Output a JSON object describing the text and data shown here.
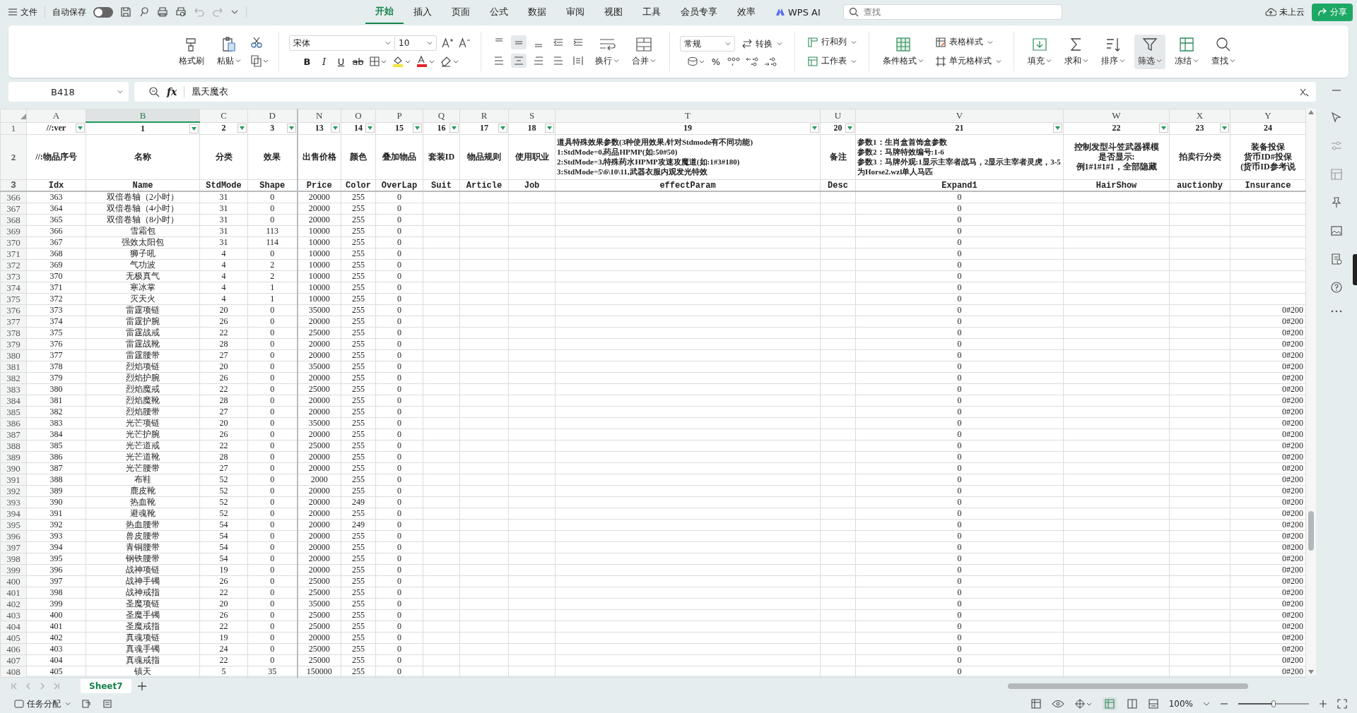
{
  "menu": {
    "file": "文件",
    "autosave": {
      "label": "自动保存",
      "on": false
    },
    "tabs": [
      {
        "label": "开始",
        "selected": true
      },
      {
        "label": "插入",
        "selected": false
      },
      {
        "label": "页面",
        "selected": false
      },
      {
        "label": "公式",
        "selected": false
      },
      {
        "label": "数据",
        "selected": false
      },
      {
        "label": "审阅",
        "selected": false
      },
      {
        "label": "视图",
        "selected": false
      },
      {
        "label": "工具",
        "selected": false
      },
      {
        "label": "会员专享",
        "selected": false
      },
      {
        "label": "效率",
        "selected": false
      },
      {
        "label": "WPS AI",
        "selected": false
      }
    ],
    "search": {
      "placeholder": "查找"
    },
    "cloud": "未上云",
    "share": "分享"
  },
  "ribbon": {
    "format_painter": "格式刷",
    "paste": "粘贴",
    "font": "宋体",
    "font_size": "10",
    "bold": "B",
    "italic": "I",
    "underline": "U",
    "strike": "ab",
    "wrap": "换行",
    "merge": "合并",
    "number_format": "常规",
    "convert": "转换",
    "percent": "%",
    "rows_cols": "行和列",
    "worksheet": "工作表",
    "conditional": "条件格式",
    "table_style": "表格样式",
    "cell_style": "单元格样式",
    "fill": "填充",
    "sum": "求和",
    "sort": "排序",
    "filter": "筛选",
    "freeze": "冻结",
    "find": "查找"
  },
  "formula_bar": {
    "name_box": "B418",
    "function_label": "fx",
    "content": "凰天魔衣"
  },
  "header_rows": [
    "1",
    "2",
    "3"
  ],
  "columns": [
    {
      "letter": "A",
      "selected": false,
      "row1": "//:ver",
      "row2": [
        "//:物品序号"
      ],
      "row3": "Idx"
    },
    {
      "letter": "B",
      "selected": true,
      "row1": "1",
      "row2": [
        "名称"
      ],
      "row3": "Name"
    },
    {
      "letter": "C",
      "selected": false,
      "row1": "2",
      "row2": [
        "分类"
      ],
      "row3": "StdMode"
    },
    {
      "letter": "D",
      "selected": false,
      "row1": "3",
      "row2": [
        "效果"
      ],
      "row3": "Shape"
    },
    {
      "letter": "N",
      "selected": false,
      "row1": "13",
      "row2": [
        "出售价格"
      ],
      "row3": "Price"
    },
    {
      "letter": "O",
      "selected": false,
      "row1": "14",
      "row2": [
        "颜色"
      ],
      "row3": "Color"
    },
    {
      "letter": "P",
      "selected": false,
      "row1": "15",
      "row2": [
        "叠加物品"
      ],
      "row3": "OverLap"
    },
    {
      "letter": "Q",
      "selected": false,
      "row1": "16",
      "row2": [
        "套装ID"
      ],
      "row3": "Suit"
    },
    {
      "letter": "R",
      "selected": false,
      "row1": "17",
      "row2": [
        "物品规则"
      ],
      "row3": "Article"
    },
    {
      "letter": "S",
      "selected": false,
      "row1": "18",
      "row2": [
        "使用职业"
      ],
      "row3": "Job"
    },
    {
      "letter": "T",
      "selected": false,
      "row1": "19",
      "row2": [
        "道具特殊效果参数(3种使用效果,针对Stdmode有不同功能)",
        "1:StdMode=0,药品HPMP(如:50#50)",
        "2:StdMode=3,特殊药水HPMP攻速攻魔道(如:1#3#180)",
        "3:StdMode=5\\6\\10\\11,武器衣服内观发光特效"
      ],
      "row3": "effectParam"
    },
    {
      "letter": "U",
      "selected": false,
      "row1": "20",
      "row2": [
        "备注"
      ],
      "row3": "Desc"
    },
    {
      "letter": "V",
      "selected": false,
      "row1": "21",
      "row2": [
        "参数1：生肖盒首饰盒参数",
        "参数2：马牌特效编号:1-6",
        "参数3：马牌外观:1显示主宰者战马，2显示主宰者灵虎，3-5为Horse2.wzl单人马匹"
      ],
      "row3": "Expand1"
    },
    {
      "letter": "W",
      "selected": false,
      "row1": "22",
      "row2": [
        "控制发型斗笠武器裸模",
        "是否显示:",
        "例1#1#1#1，全部隐藏"
      ],
      "row3": "HairShow"
    },
    {
      "letter": "X",
      "selected": false,
      "row1": "23",
      "row2": [
        "拍卖行分类"
      ],
      "row3": "auctionby"
    },
    {
      "letter": "Y",
      "selected": false,
      "row1": "24",
      "row2": [
        "装备投保",
        "货币ID#投保",
        "(货币ID参考说"
      ],
      "row3": "Insurance"
    }
  ],
  "rows": [
    {
      "row": "366",
      "cells": {
        "A": "363",
        "B": "双倍卷轴（2小时）",
        "C": "31",
        "D": "0",
        "N": "20000",
        "O": "255",
        "P": "0",
        "V": "0"
      }
    },
    {
      "row": "367",
      "cells": {
        "A": "364",
        "B": "双倍卷轴（4小时）",
        "C": "31",
        "D": "0",
        "N": "20000",
        "O": "255",
        "P": "0",
        "V": "0"
      }
    },
    {
      "row": "368",
      "cells": {
        "A": "365",
        "B": "双倍卷轴（8小时）",
        "C": "31",
        "D": "0",
        "N": "20000",
        "O": "255",
        "P": "0",
        "V": "0"
      }
    },
    {
      "row": "369",
      "cells": {
        "A": "366",
        "B": "雪霜包",
        "C": "31",
        "D": "113",
        "N": "10000",
        "O": "255",
        "P": "0",
        "V": "0"
      }
    },
    {
      "row": "370",
      "cells": {
        "A": "367",
        "B": "强效太阳包",
        "C": "31",
        "D": "114",
        "N": "10000",
        "O": "255",
        "P": "0",
        "V": "0"
      }
    },
    {
      "row": "371",
      "cells": {
        "A": "368",
        "B": "狮子吼",
        "C": "4",
        "D": "0",
        "N": "10000",
        "O": "255",
        "P": "0",
        "V": "0"
      }
    },
    {
      "row": "372",
      "cells": {
        "A": "369",
        "B": "气功波",
        "C": "4",
        "D": "2",
        "N": "10000",
        "O": "255",
        "P": "0",
        "V": "0"
      }
    },
    {
      "row": "373",
      "cells": {
        "A": "370",
        "B": "无极真气",
        "C": "4",
        "D": "2",
        "N": "10000",
        "O": "255",
        "P": "0",
        "V": "0"
      }
    },
    {
      "row": "374",
      "cells": {
        "A": "371",
        "B": "寒冰掌",
        "C": "4",
        "D": "1",
        "N": "10000",
        "O": "255",
        "P": "0",
        "V": "0"
      }
    },
    {
      "row": "375",
      "cells": {
        "A": "372",
        "B": "灭天火",
        "C": "4",
        "D": "1",
        "N": "10000",
        "O": "255",
        "P": "0",
        "V": "0"
      }
    },
    {
      "row": "376",
      "cells": {
        "A": "373",
        "B": "雷霆项链",
        "C": "20",
        "D": "0",
        "N": "35000",
        "O": "255",
        "P": "0",
        "V": "0",
        "Y": "0#200"
      }
    },
    {
      "row": "377",
      "cells": {
        "A": "374",
        "B": "雷霆护腕",
        "C": "26",
        "D": "0",
        "N": "20000",
        "O": "255",
        "P": "0",
        "V": "0",
        "Y": "0#200"
      }
    },
    {
      "row": "378",
      "cells": {
        "A": "375",
        "B": "雷霆战戒",
        "C": "22",
        "D": "0",
        "N": "25000",
        "O": "255",
        "P": "0",
        "V": "0",
        "Y": "0#200"
      }
    },
    {
      "row": "379",
      "cells": {
        "A": "376",
        "B": "雷霆战靴",
        "C": "28",
        "D": "0",
        "N": "20000",
        "O": "255",
        "P": "0",
        "V": "0",
        "Y": "0#200"
      }
    },
    {
      "row": "380",
      "cells": {
        "A": "377",
        "B": "雷霆腰带",
        "C": "27",
        "D": "0",
        "N": "20000",
        "O": "255",
        "P": "0",
        "V": "0",
        "Y": "0#200"
      }
    },
    {
      "row": "381",
      "cells": {
        "A": "378",
        "B": "烈焰项链",
        "C": "20",
        "D": "0",
        "N": "35000",
        "O": "255",
        "P": "0",
        "V": "0",
        "Y": "0#200"
      }
    },
    {
      "row": "382",
      "cells": {
        "A": "379",
        "B": "烈焰护腕",
        "C": "26",
        "D": "0",
        "N": "20000",
        "O": "255",
        "P": "0",
        "V": "0",
        "Y": "0#200"
      }
    },
    {
      "row": "383",
      "cells": {
        "A": "380",
        "B": "烈焰魔戒",
        "C": "22",
        "D": "0",
        "N": "25000",
        "O": "255",
        "P": "0",
        "V": "0",
        "Y": "0#200"
      }
    },
    {
      "row": "384",
      "cells": {
        "A": "381",
        "B": "烈焰魔靴",
        "C": "28",
        "D": "0",
        "N": "20000",
        "O": "255",
        "P": "0",
        "V": "0",
        "Y": "0#200"
      }
    },
    {
      "row": "385",
      "cells": {
        "A": "382",
        "B": "烈焰腰带",
        "C": "27",
        "D": "0",
        "N": "20000",
        "O": "255",
        "P": "0",
        "V": "0",
        "Y": "0#200"
      }
    },
    {
      "row": "386",
      "cells": {
        "A": "383",
        "B": "光芒项链",
        "C": "20",
        "D": "0",
        "N": "35000",
        "O": "255",
        "P": "0",
        "V": "0",
        "Y": "0#200"
      }
    },
    {
      "row": "387",
      "cells": {
        "A": "384",
        "B": "光芒护腕",
        "C": "26",
        "D": "0",
        "N": "20000",
        "O": "255",
        "P": "0",
        "V": "0",
        "Y": "0#200"
      }
    },
    {
      "row": "388",
      "cells": {
        "A": "385",
        "B": "光芒道戒",
        "C": "22",
        "D": "0",
        "N": "25000",
        "O": "255",
        "P": "0",
        "V": "0",
        "Y": "0#200"
      }
    },
    {
      "row": "389",
      "cells": {
        "A": "386",
        "B": "光芒道靴",
        "C": "28",
        "D": "0",
        "N": "20000",
        "O": "255",
        "P": "0",
        "V": "0",
        "Y": "0#200"
      }
    },
    {
      "row": "390",
      "cells": {
        "A": "387",
        "B": "光芒腰带",
        "C": "27",
        "D": "0",
        "N": "20000",
        "O": "255",
        "P": "0",
        "V": "0",
        "Y": "0#200"
      }
    },
    {
      "row": "391",
      "cells": {
        "A": "388",
        "B": "布鞋",
        "C": "52",
        "D": "0",
        "N": "2000",
        "O": "255",
        "P": "0",
        "V": "0",
        "Y": "0#200"
      }
    },
    {
      "row": "392",
      "cells": {
        "A": "389",
        "B": "鹿皮靴",
        "C": "52",
        "D": "0",
        "N": "20000",
        "O": "255",
        "P": "0",
        "V": "0",
        "Y": "0#200"
      }
    },
    {
      "row": "393",
      "cells": {
        "A": "390",
        "B": "热血靴",
        "C": "52",
        "D": "0",
        "N": "20000",
        "O": "249",
        "P": "0",
        "V": "0",
        "Y": "0#200"
      }
    },
    {
      "row": "394",
      "cells": {
        "A": "391",
        "B": "避魂靴",
        "C": "52",
        "D": "0",
        "N": "20000",
        "O": "255",
        "P": "0",
        "V": "0",
        "Y": "0#200"
      }
    },
    {
      "row": "395",
      "cells": {
        "A": "392",
        "B": "热血腰带",
        "C": "54",
        "D": "0",
        "N": "20000",
        "O": "249",
        "P": "0",
        "V": "0",
        "Y": "0#200"
      }
    },
    {
      "row": "396",
      "cells": {
        "A": "393",
        "B": "兽皮腰带",
        "C": "54",
        "D": "0",
        "N": "20000",
        "O": "255",
        "P": "0",
        "V": "0",
        "Y": "0#200"
      }
    },
    {
      "row": "397",
      "cells": {
        "A": "394",
        "B": "青铜腰带",
        "C": "54",
        "D": "0",
        "N": "20000",
        "O": "255",
        "P": "0",
        "V": "0",
        "Y": "0#200"
      }
    },
    {
      "row": "398",
      "cells": {
        "A": "395",
        "B": "钢铁腰带",
        "C": "54",
        "D": "0",
        "N": "20000",
        "O": "255",
        "P": "0",
        "V": "0",
        "Y": "0#200"
      }
    },
    {
      "row": "399",
      "cells": {
        "A": "396",
        "B": "战神项链",
        "C": "19",
        "D": "0",
        "N": "20000",
        "O": "255",
        "P": "0",
        "V": "0",
        "Y": "0#200"
      }
    },
    {
      "row": "400",
      "cells": {
        "A": "397",
        "B": "战神手镯",
        "C": "26",
        "D": "0",
        "N": "25000",
        "O": "255",
        "P": "0",
        "V": "0",
        "Y": "0#200"
      }
    },
    {
      "row": "401",
      "cells": {
        "A": "398",
        "B": "战神戒指",
        "C": "22",
        "D": "0",
        "N": "25000",
        "O": "255",
        "P": "0",
        "V": "0",
        "Y": "0#200"
      }
    },
    {
      "row": "402",
      "cells": {
        "A": "399",
        "B": "圣魔项链",
        "C": "20",
        "D": "0",
        "N": "35000",
        "O": "255",
        "P": "0",
        "V": "0",
        "Y": "0#200"
      }
    },
    {
      "row": "403",
      "cells": {
        "A": "400",
        "B": "圣魔手镯",
        "C": "26",
        "D": "0",
        "N": "25000",
        "O": "255",
        "P": "0",
        "V": "0",
        "Y": "0#200"
      }
    },
    {
      "row": "404",
      "cells": {
        "A": "401",
        "B": "圣魔戒指",
        "C": "22",
        "D": "0",
        "N": "25000",
        "O": "255",
        "P": "0",
        "V": "0",
        "Y": "0#200"
      }
    },
    {
      "row": "405",
      "cells": {
        "A": "402",
        "B": "真魂项链",
        "C": "19",
        "D": "0",
        "N": "20000",
        "O": "255",
        "P": "0",
        "V": "0",
        "Y": "0#200"
      }
    },
    {
      "row": "406",
      "cells": {
        "A": "403",
        "B": "真魂手镯",
        "C": "24",
        "D": "0",
        "N": "25000",
        "O": "255",
        "P": "0",
        "V": "0",
        "Y": "0#200"
      }
    },
    {
      "row": "407",
      "cells": {
        "A": "404",
        "B": "真魂戒指",
        "C": "22",
        "D": "0",
        "N": "25000",
        "O": "255",
        "P": "0",
        "V": "0",
        "Y": "0#200"
      }
    },
    {
      "row": "408",
      "cells": {
        "A": "405",
        "B": "镇天",
        "C": "5",
        "D": "35",
        "N": "150000",
        "O": "255",
        "P": "0",
        "V": "0",
        "Y": "0#200"
      }
    }
  ],
  "sheets": [
    {
      "label": "Sheet7",
      "selected": true
    }
  ],
  "status_bar": {
    "task": "任务分配",
    "zoom": "100%",
    "zoom_slider": {
      "level": 0.5
    }
  }
}
